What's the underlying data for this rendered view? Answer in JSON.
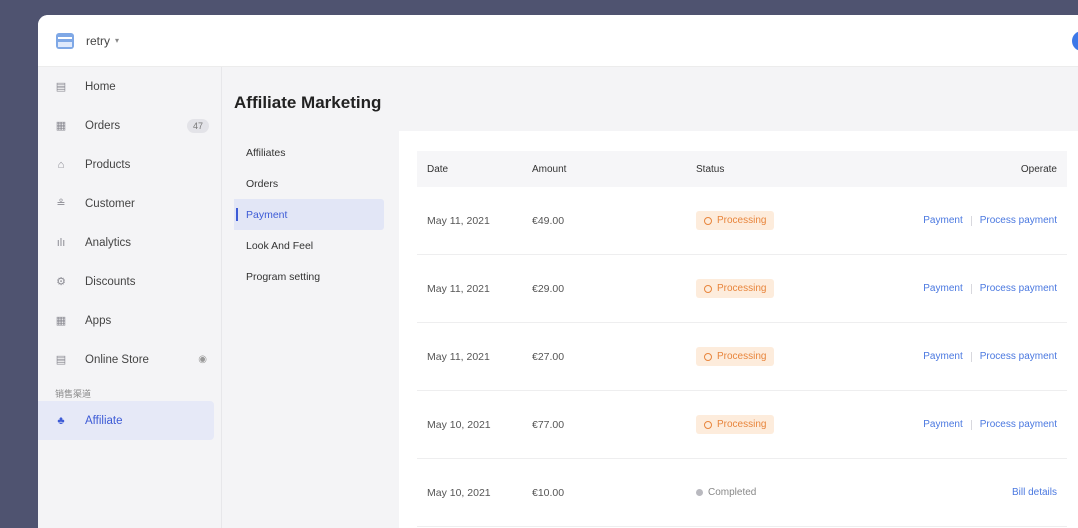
{
  "topbar": {
    "store_name": "retry",
    "caret": "▾"
  },
  "sidebar": {
    "items": [
      {
        "label": "Home",
        "icon": "home-icon",
        "glyph": "▤"
      },
      {
        "label": "Orders",
        "icon": "orders-icon",
        "glyph": "▦",
        "badge": "47"
      },
      {
        "label": "Products",
        "icon": "products-icon",
        "glyph": "⌂"
      },
      {
        "label": "Customer",
        "icon": "customer-icon",
        "glyph": "≗"
      },
      {
        "label": "Analytics",
        "icon": "analytics-icon",
        "glyph": "ılı"
      },
      {
        "label": "Discounts",
        "icon": "discounts-icon",
        "glyph": "⚙"
      },
      {
        "label": "Apps",
        "icon": "apps-icon",
        "glyph": "▦"
      },
      {
        "label": "Online Store",
        "icon": "online-store-icon",
        "glyph": "▤",
        "eye": "◉"
      }
    ],
    "section_label": "销售渠道",
    "affiliate": {
      "label": "Affiliate",
      "icon": "affiliate-icon",
      "glyph": "♣"
    }
  },
  "main": {
    "title": "Affiliate Marketing",
    "subnav": [
      "Affiliates",
      "Orders",
      "Payment",
      "Look And Feel",
      "Program setting"
    ],
    "active_subnav": "Payment"
  },
  "table": {
    "headers": {
      "date": "Date",
      "amount": "Amount",
      "status": "Status",
      "operate": "Operate"
    },
    "rows": [
      {
        "date": "May 11, 2021",
        "amount": "€49.00",
        "status": "Processing",
        "op1": "Payment",
        "op2": "Process payment"
      },
      {
        "date": "May 11, 2021",
        "amount": "€29.00",
        "status": "Processing",
        "op1": "Payment",
        "op2": "Process payment"
      },
      {
        "date": "May 11, 2021",
        "amount": "€27.00",
        "status": "Processing",
        "op1": "Payment",
        "op2": "Process payment"
      },
      {
        "date": "May 10, 2021",
        "amount": "€77.00",
        "status": "Processing",
        "op1": "Payment",
        "op2": "Process payment"
      },
      {
        "date": "May 10, 2021",
        "amount": "€10.00",
        "status": "Completed",
        "op1": "Bill details"
      }
    ]
  },
  "colors": {
    "accent": "#3d5bd6",
    "processing": "#e8853c",
    "link": "#4a78e0",
    "backdrop": "#4f5370"
  }
}
